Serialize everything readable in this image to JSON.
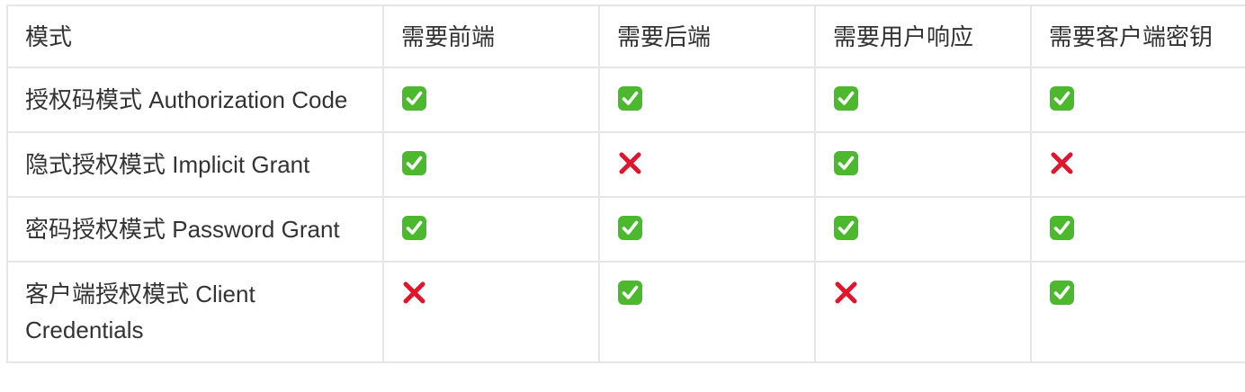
{
  "table": {
    "headers": [
      "模式",
      "需要前端",
      "需要后端",
      "需要用户响应",
      "需要客户端密钥"
    ],
    "rows": [
      {
        "mode": "授权码模式 Authorization Code",
        "values": [
          "yes",
          "yes",
          "yes",
          "yes"
        ]
      },
      {
        "mode": "隐式授权模式 Implicit Grant",
        "values": [
          "yes",
          "no",
          "yes",
          "no"
        ]
      },
      {
        "mode": "密码授权模式 Password Grant",
        "values": [
          "yes",
          "yes",
          "yes",
          "yes"
        ]
      },
      {
        "mode": "客户端授权模式 Client Credentials",
        "values": [
          "no",
          "yes",
          "no",
          "yes"
        ]
      }
    ]
  },
  "icons": {
    "yes": "check-mark-button-icon",
    "no": "cross-mark-icon"
  },
  "colors": {
    "check_green": "#4cb82e",
    "cross_red": "#e0142b",
    "border": "#e6e6e6",
    "text": "#333333"
  }
}
